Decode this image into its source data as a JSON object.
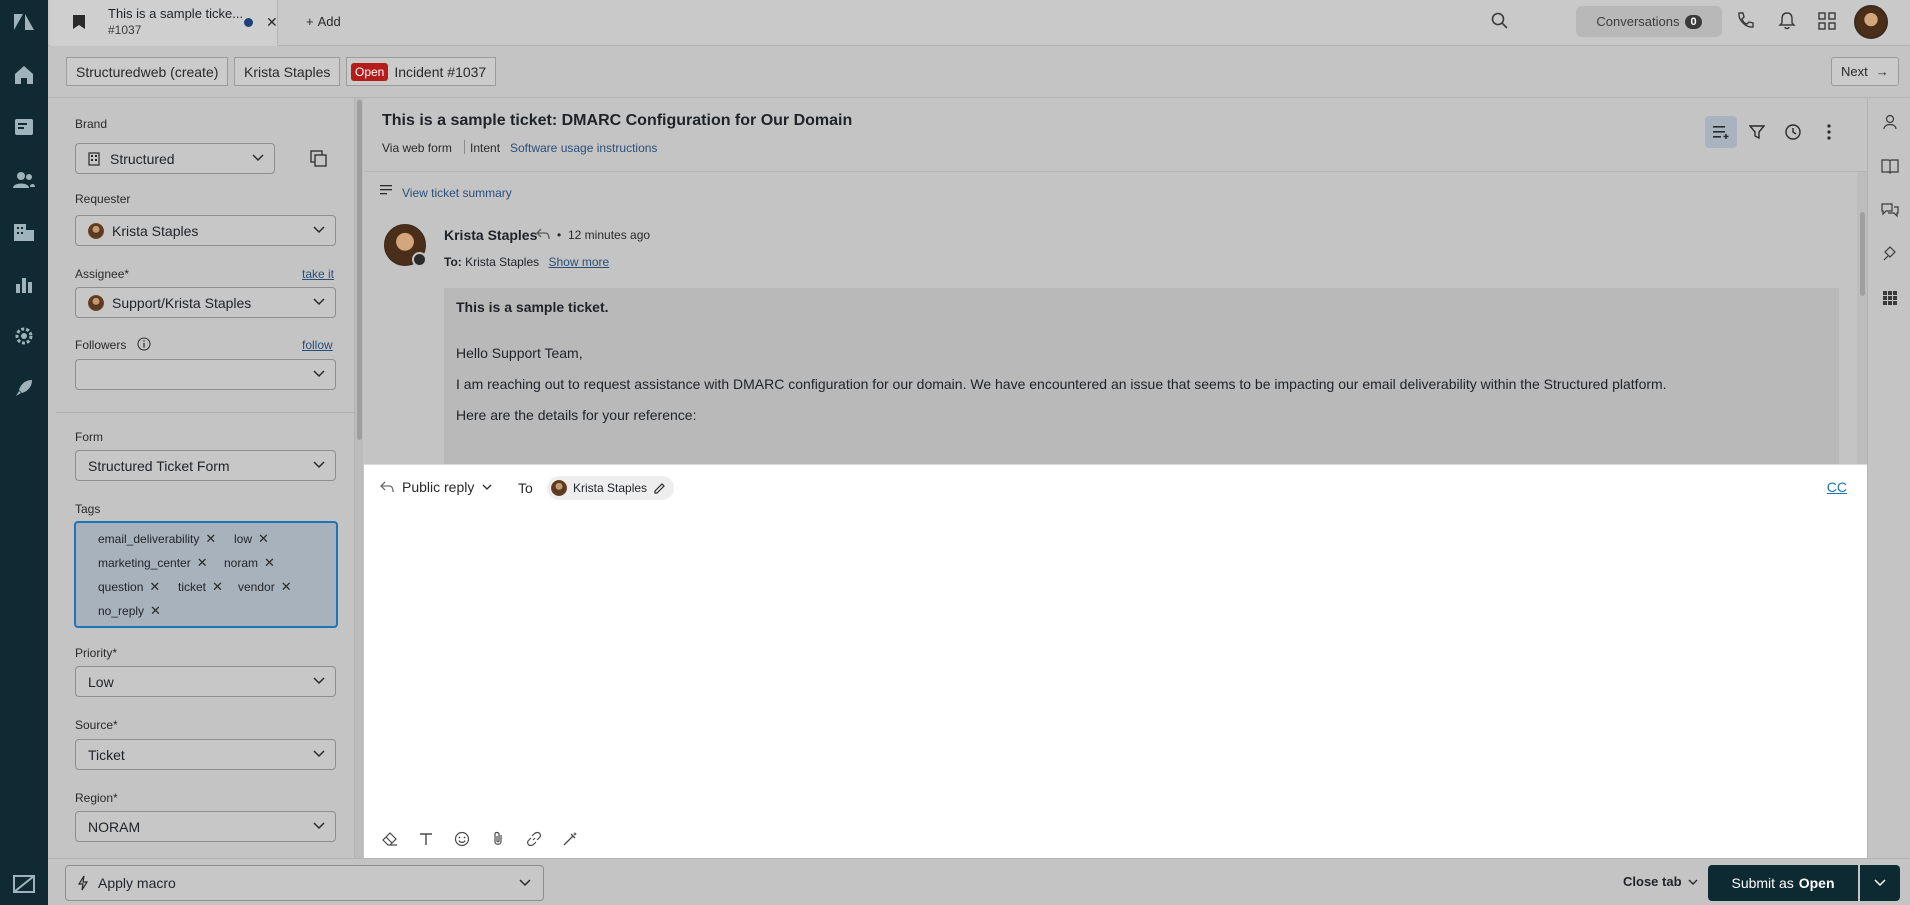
{
  "top_tab": {
    "title": "This is a sample ticke...",
    "number": "#1037",
    "add_label": "Add"
  },
  "conversations": {
    "label": "Conversations",
    "count": "0"
  },
  "breadcrumb": {
    "org": "Structuredweb (create)",
    "requester": "Krista Staples",
    "status": "Open",
    "ticket": "Incident #1037",
    "next_label": "Next"
  },
  "panel": {
    "brand": {
      "label": "Brand",
      "value": "Structured"
    },
    "requester": {
      "label": "Requester",
      "value": "Krista Staples"
    },
    "assignee": {
      "label": "Assignee*",
      "value": "Support/Krista Staples",
      "action": "take it"
    },
    "followers": {
      "label": "Followers",
      "action": "follow",
      "value": ""
    },
    "form": {
      "label": "Form",
      "value": "Structured Ticket Form"
    },
    "tags_label": "Tags",
    "tags": [
      "email_deliverability",
      "low",
      "marketing_center",
      "noram",
      "question",
      "ticket",
      "vendor",
      "no_reply"
    ],
    "priority": {
      "label": "Priority*",
      "value": "Low"
    },
    "source": {
      "label": "Source*",
      "value": "Ticket"
    },
    "region": {
      "label": "Region*",
      "value": "NORAM"
    }
  },
  "ticket": {
    "title": "This is a sample ticket: DMARC Configuration for Our Domain",
    "via": "Via web form",
    "intent_label": "Intent",
    "intent_value": "Software usage instructions",
    "summary_link": "View ticket summary"
  },
  "message": {
    "author": "Krista Staples",
    "time": "12 minutes ago",
    "to_label": "To:",
    "to_value": "Krista Staples",
    "show_more": "Show more",
    "lines": [
      "This is a sample ticket.",
      "Hello Support Team,",
      "I am reaching out to request assistance with DMARC configuration for our domain. We have encountered an issue that seems to be impacting our email deliverability within the Structured platform.",
      "Here are the details for your reference:"
    ]
  },
  "composer": {
    "type": "Public reply",
    "to_label": "To",
    "recipient": "Krista Staples",
    "cc": "CC"
  },
  "bottom": {
    "macro": "Apply macro",
    "close_tab": "Close tab",
    "submit_prefix": "Submit as",
    "submit_status": "Open"
  }
}
